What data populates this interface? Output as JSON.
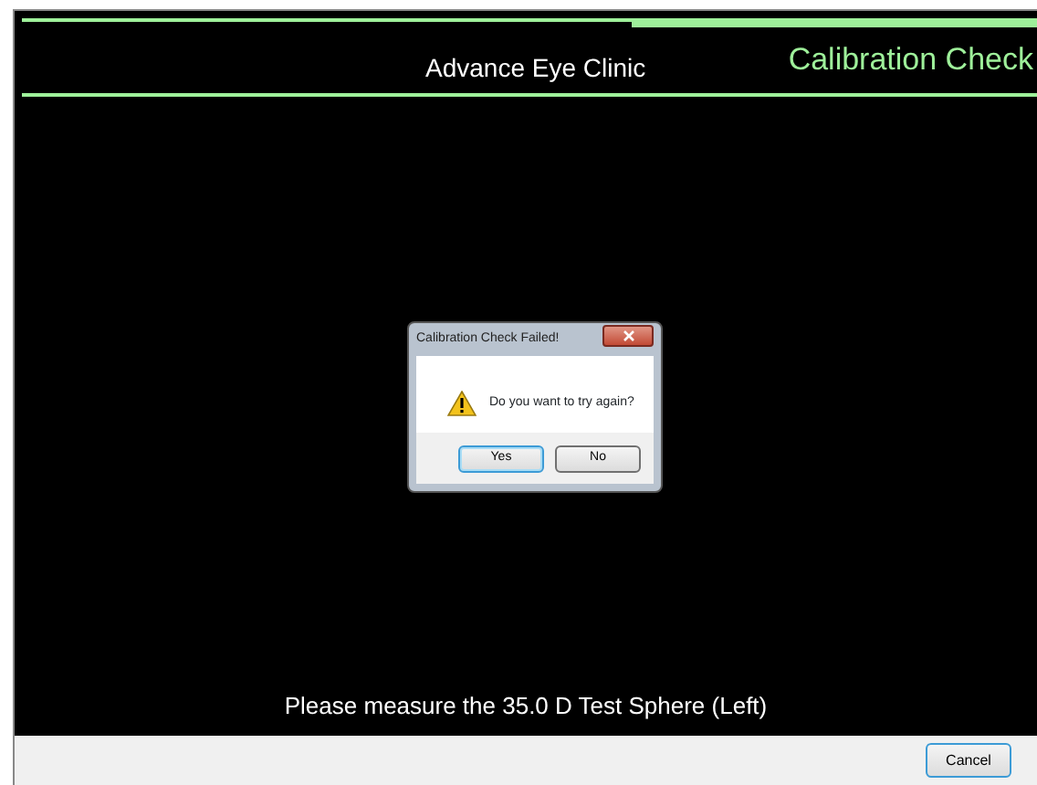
{
  "header": {
    "clinic": "Advance Eye Clinic",
    "title": "Calibration Check"
  },
  "dialog": {
    "title": "Calibration Check Failed!",
    "message": "Do you want to try again?",
    "buttons": [
      {
        "label": "Yes",
        "default": true
      },
      {
        "label": "No",
        "default": false
      }
    ]
  },
  "instruction": "Please measure the 35.0 D Test Sphere (Left)",
  "footer": {
    "buttons": [
      {
        "label": "Cancel"
      }
    ]
  }
}
